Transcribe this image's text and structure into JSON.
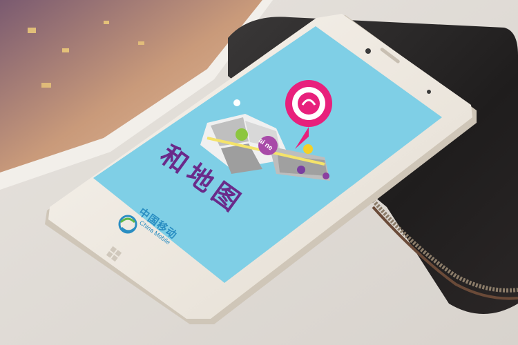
{
  "app": {
    "title": "和地图",
    "icon_badge": "ai ne",
    "primary_color": "#7fcfe6",
    "accent_color": "#e8207c",
    "title_color": "#6a2a8a"
  },
  "phone": {
    "body_color": "#f1ece4",
    "carrier_name_cn": "中国移动",
    "carrier_name_en": "China Mobile",
    "home_button_icon": "windows-logo-icon"
  },
  "scene": {
    "background_objects": [
      "magazine",
      "leather-wallet"
    ]
  }
}
